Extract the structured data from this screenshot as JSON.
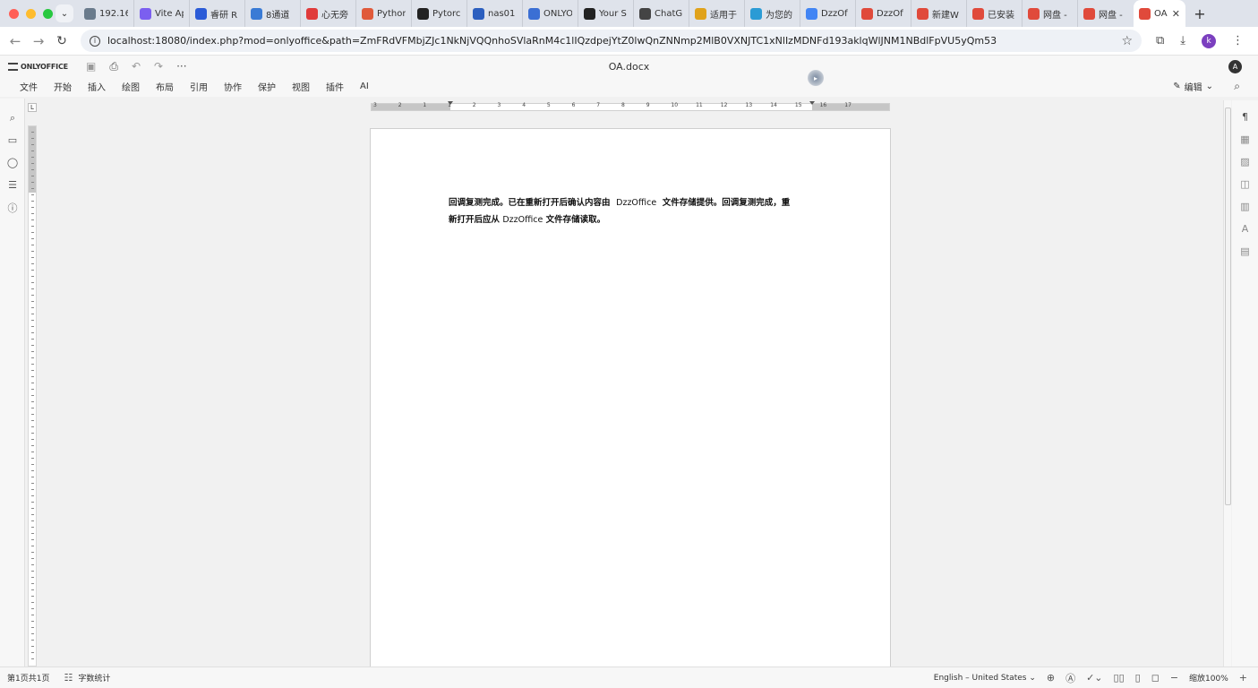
{
  "browser": {
    "tabs": [
      {
        "title": "192.16",
        "icon": "chart-icon",
        "color": "#6a7b8c"
      },
      {
        "title": "Vite Ap",
        "icon": "vite-icon",
        "color": "#7b5ff0"
      },
      {
        "title": "睿研 R",
        "icon": "doc-icon",
        "color": "#2b5bd7"
      },
      {
        "title": "8通道",
        "icon": "doc-icon",
        "color": "#3a7bd5"
      },
      {
        "title": "心无旁",
        "icon": "c-icon",
        "color": "#e03b3b"
      },
      {
        "title": "Python",
        "icon": "c-icon",
        "color": "#e05a3b"
      },
      {
        "title": "Pytorc",
        "icon": "github-icon",
        "color": "#222222"
      },
      {
        "title": "nas01",
        "icon": "nas-icon",
        "color": "#2c5fbf"
      },
      {
        "title": "ONLYO",
        "icon": "check-icon",
        "color": "#3b6fd4"
      },
      {
        "title": "Your S",
        "icon": "github-icon",
        "color": "#222222"
      },
      {
        "title": "ChatG",
        "icon": "openai-icon",
        "color": "#444444"
      },
      {
        "title": "适用于",
        "icon": "layers-icon",
        "color": "#e0a21b"
      },
      {
        "title": "为您的",
        "icon": "layers-icon",
        "color": "#2b9bd5"
      },
      {
        "title": "DzzOf",
        "icon": "google-icon",
        "color": "#4285f4"
      },
      {
        "title": "DzzOf",
        "icon": "dzz-icon",
        "color": "#e04a3b"
      },
      {
        "title": "新建W",
        "icon": "dzz-icon",
        "color": "#e04a3b"
      },
      {
        "title": "已安装",
        "icon": "dzz-icon",
        "color": "#e04a3b"
      },
      {
        "title": "网盘 -",
        "icon": "dzz-icon",
        "color": "#e04a3b"
      },
      {
        "title": "网盘 -",
        "icon": "dzz-icon",
        "color": "#e04a3b"
      }
    ],
    "active_tab": {
      "title": "OA",
      "icon": "dzz-icon",
      "color": "#e04a3b"
    },
    "url": "localhost:18080/index.php?mod=onlyoffice&path=ZmFRdVFMbjZJc1NkNjVQQnhoSVlaRnM4c1lIQzdpejYtZ0lwQnZNNmp2MlB0VXNJTC1xNlIzMDNFd193aklqWlJNM1NBdlFpVU5yQm53",
    "profile_initial": "k"
  },
  "app": {
    "logo_text": "ONLYOFFICE",
    "doc_title": "OA.docx",
    "user_initial": "A",
    "menu": [
      "文件",
      "开始",
      "插入",
      "绘图",
      "布局",
      "引用",
      "协作",
      "保护",
      "视图",
      "插件",
      "AI"
    ],
    "edit_mode": "编辑"
  },
  "document": {
    "line1_part1": "回调复测完成。已在重新打开后确认内容由",
    "line1_brand": "DzzOffice",
    "line1_part2": "文件存储提供。回调复测完成，重",
    "line2_part1": "新打开后应从",
    "line2_brand": "DzzOffice",
    "line2_part2": "文件存储读取。"
  },
  "ruler": {
    "h_numbers": [
      "3",
      "2",
      "1",
      "1",
      "2",
      "3",
      "4",
      "5",
      "6",
      "7",
      "8",
      "9",
      "10",
      "11",
      "12",
      "13",
      "14",
      "15",
      "16",
      "17"
    ]
  },
  "status": {
    "page_info": "第1页共1页",
    "word_count": "字数统计",
    "language": "English – United States",
    "zoom": "缩放100%"
  }
}
